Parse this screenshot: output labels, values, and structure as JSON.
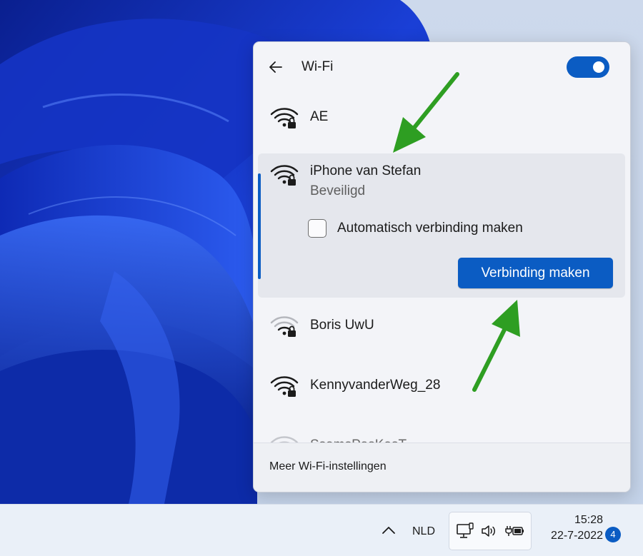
{
  "flyout": {
    "title": "Wi-Fi",
    "toggle_state": "on",
    "networks": [
      {
        "name": "AE",
        "signal": "full",
        "secured": true
      },
      {
        "name": "iPhone van Stefan",
        "status": "Beveiligd",
        "signal": "full",
        "secured": true,
        "selected": true,
        "auto_connect_label": "Automatisch verbinding maken",
        "auto_connect_checked": false,
        "connect_label": "Verbinding maken"
      },
      {
        "name": "Boris UwU",
        "signal": "weak",
        "secured": true
      },
      {
        "name": "KennyvanderWeg_28",
        "signal": "full",
        "secured": true
      },
      {
        "name": "SsamsPasKasT",
        "signal": "weak",
        "secured": false,
        "partially_visible": true
      }
    ],
    "footer_link": "Meer Wi-Fi-instellingen"
  },
  "taskbar": {
    "language": "NLD",
    "time": "15:28",
    "date": "22-7-2022",
    "notification_count": "4",
    "tray_icons": [
      "network-icon",
      "volume-icon",
      "battery-charging-icon"
    ]
  },
  "colors": {
    "accent": "#0b5cc3",
    "annotation_arrow": "#2e9e22",
    "wallpaper_blue": "#1638c8"
  }
}
